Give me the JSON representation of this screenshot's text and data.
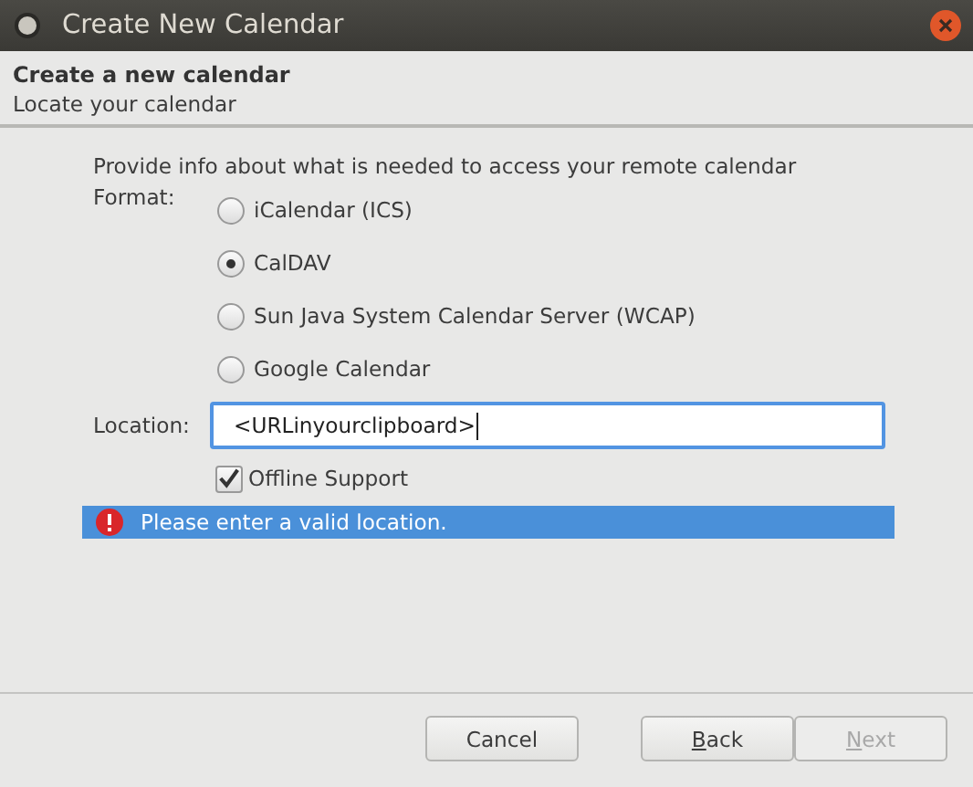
{
  "window": {
    "title": "Create New Calendar"
  },
  "header": {
    "title": "Create a new calendar",
    "subtitle": "Locate your calendar"
  },
  "intro": "Provide info about what is needed to access your remote calendar",
  "format": {
    "label": "Format:",
    "options": [
      {
        "label": "iCalendar (ICS)",
        "selected": false
      },
      {
        "label": "CalDAV",
        "selected": true
      },
      {
        "label": "Sun Java System Calendar Server (WCAP)",
        "selected": false
      },
      {
        "label": "Google Calendar",
        "selected": false
      }
    ]
  },
  "location": {
    "label": "Location:",
    "value": "<URLinyourclipboard>"
  },
  "offline": {
    "label": "Offline Support",
    "checked": true
  },
  "error": {
    "message": "Please enter a valid location."
  },
  "buttons": [
    {
      "label": "Cancel",
      "mnemonic_first": false,
      "disabled": false
    },
    {
      "label": "Back",
      "mnemonic_first": true,
      "disabled": false
    },
    {
      "label": "Next",
      "mnemonic_first": true,
      "disabled": true
    }
  ]
}
